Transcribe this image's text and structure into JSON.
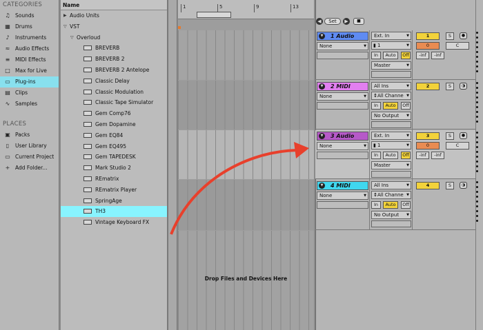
{
  "categories": {
    "heading": "CATEGORIES",
    "items": [
      {
        "label": "Sounds",
        "icon": "speaker-icon"
      },
      {
        "label": "Drums",
        "icon": "drums-grid-icon"
      },
      {
        "label": "Instruments",
        "icon": "instrument-icon"
      },
      {
        "label": "Audio Effects",
        "icon": "audio-effects-icon"
      },
      {
        "label": "MIDI Effects",
        "icon": "midi-effects-icon"
      },
      {
        "label": "Max for Live",
        "icon": "max-for-live-icon"
      },
      {
        "label": "Plug-ins",
        "icon": "plugin-icon"
      },
      {
        "label": "Clips",
        "icon": "clip-icon"
      },
      {
        "label": "Samples",
        "icon": "sample-waveform-icon"
      }
    ],
    "places_heading": "PLACES",
    "places": [
      {
        "label": "Packs",
        "icon": "packs-icon"
      },
      {
        "label": "User Library",
        "icon": "user-library-icon"
      },
      {
        "label": "Current Project",
        "icon": "current-project-icon"
      },
      {
        "label": "Add Folder...",
        "icon": "add-folder-icon"
      }
    ]
  },
  "browser": {
    "column_header": "Name",
    "folders": [
      "Audio Units",
      "VST",
      "Overloud"
    ],
    "plugins": [
      "BREVERB",
      "BREVERB 2",
      "BREVERB 2 Antelope",
      "Classic Delay",
      "Classic Modulation",
      "Classic Tape Simulator",
      "Gem Comp76",
      "Gem Dopamine",
      "Gem EQ84",
      "Gem EQ495",
      "Gem TAPEDESK",
      "Mark Studio 2",
      "REmatrix",
      "REmatrix Player",
      "SpringAge",
      "TH3",
      "Vintage Keyboard FX"
    ],
    "selected": "TH3"
  },
  "ruler": {
    "ticks": [
      "1",
      "5",
      "9",
      "13"
    ]
  },
  "drop_text": "Drop Files and Devices Here",
  "transport": {
    "set_label": "Set"
  },
  "tracks": [
    {
      "name": "1 Audio",
      "type": "audio",
      "color": "#5f8bf2",
      "input_type": "Ext. In",
      "input_channel": "1",
      "clip_slot": "None",
      "monitor": [
        "In",
        "Auto",
        "Off"
      ],
      "output": "Master",
      "number": "1",
      "volume": "0",
      "pan": "C",
      "meter_l": "-inf",
      "meter_r": "-inf"
    },
    {
      "name": "2 MIDI",
      "type": "midi",
      "color": "#e27ff0",
      "input_type": "All Ins",
      "input_channel": "All Channe",
      "clip_slot": "None",
      "monitor": [
        "In",
        "Auto",
        "Off"
      ],
      "output": "No Output",
      "number": "2"
    },
    {
      "name": "3 Audio",
      "type": "audio",
      "color": "#b659c8",
      "input_type": "Ext. In",
      "input_channel": "1",
      "clip_slot": "None",
      "monitor": [
        "In",
        "Auto",
        "Off"
      ],
      "output": "Master",
      "number": "3",
      "volume": "0",
      "pan": "C",
      "meter_l": "-inf",
      "meter_r": "-inf"
    },
    {
      "name": "4 MIDI",
      "type": "midi",
      "color": "#40d7ef",
      "input_type": "All Ins",
      "input_channel": "All Channe",
      "clip_slot": "None",
      "monitor": [
        "In",
        "Auto",
        "Off"
      ],
      "output": "No Output",
      "number": "4"
    }
  ],
  "colors": {
    "selection": "#88f4ff",
    "arm_yellow": "#f2d23a",
    "volume_orange": "#e98c52",
    "arrow_red": "#e8402c"
  }
}
